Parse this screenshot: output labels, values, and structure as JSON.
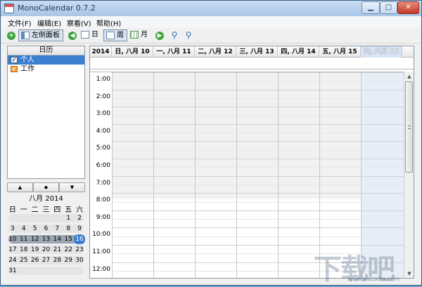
{
  "window": {
    "title": "MonoCalendar 0.7.2",
    "min_glyph": "▁",
    "max_glyph": "□",
    "close_glyph": "✕"
  },
  "menu": [
    "文件(F)",
    "编辑(E)",
    "察看(V)",
    "帮助(H)"
  ],
  "toolbar": {
    "left_panel_label": "左侧面板",
    "day_label": "日",
    "week_label": "周",
    "month_label": "月",
    "active_view": "周"
  },
  "left_panel": {
    "header": "日历",
    "calendars": [
      {
        "name": "个人",
        "checked": true,
        "color": "#3b7fd1",
        "selected": true
      },
      {
        "name": "工作",
        "checked": true,
        "color": "#f2a13a",
        "selected": false
      }
    ]
  },
  "mini_calendar": {
    "nav": [
      "▲",
      "◆",
      "▼"
    ],
    "title": "八月 2014",
    "weekdays": [
      "日",
      "一",
      "二",
      "三",
      "四",
      "五",
      "六"
    ],
    "weeks": [
      [
        "",
        "",
        "",
        "",
        "",
        "1",
        "2"
      ],
      [
        "3",
        "4",
        "5",
        "6",
        "7",
        "8",
        "9"
      ],
      [
        "10",
        "11",
        "12",
        "13",
        "14",
        "15",
        "16"
      ],
      [
        "17",
        "18",
        "19",
        "20",
        "21",
        "22",
        "23"
      ],
      [
        "24",
        "25",
        "26",
        "27",
        "28",
        "29",
        "30"
      ],
      [
        "31",
        "",
        "",
        "",
        "",
        "",
        ""
      ]
    ],
    "current_week_index": 2,
    "today": "16"
  },
  "week_view": {
    "year": "2014",
    "days": [
      "日, 八月 10",
      "一, 八月 11",
      "二, 八月 12",
      "三, 八月 13",
      "四, 八月 14",
      "五, 八月 15",
      "六, 八月 16"
    ],
    "today_index": 6,
    "times": [
      "1:00",
      "2:00",
      "3:00",
      "4:00",
      "5:00",
      "6:00",
      "7:00",
      "8:00",
      "9:00",
      "10:00",
      "11:00",
      "12:00"
    ]
  },
  "watermark": {
    "text": "下载吧",
    "url": "www.xiazaiba.com"
  }
}
